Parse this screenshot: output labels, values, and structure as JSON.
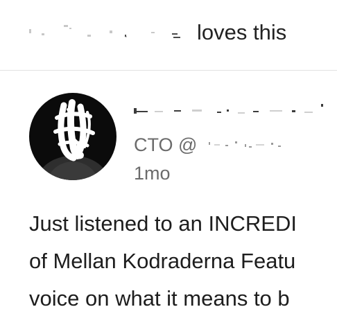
{
  "activity": {
    "action_text": "loves this"
  },
  "post": {
    "author": {
      "headline_prefix": "CTO @"
    },
    "time": "1mo",
    "body_lines": [
      "Just listened to an INCREDI",
      "of Mellan Kodraderna Featu",
      "voice on what it means to b"
    ]
  }
}
